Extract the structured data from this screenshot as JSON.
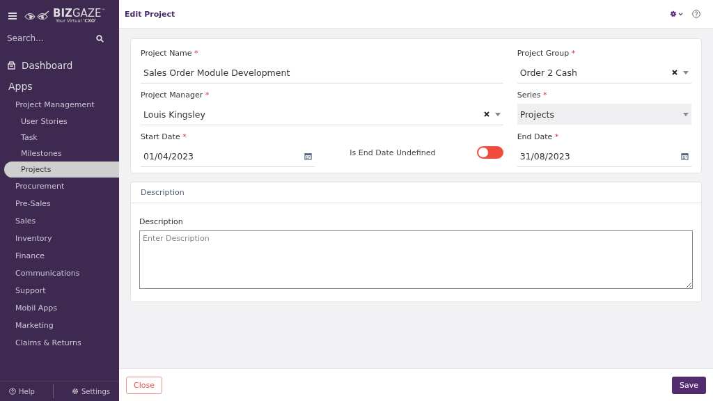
{
  "sidebar": {
    "logo": {
      "brand_bold": "BIZ",
      "brand": "GAZE",
      "tm": "™",
      "tagline": "Your Virtual **'CXO'**."
    },
    "search": {
      "placeholder": "Search..."
    },
    "dashboard": "Dashboard",
    "section": "Apps",
    "items": [
      {
        "label": "Project Management",
        "selected": false,
        "children": [
          {
            "label": "User Stories",
            "selected": false
          },
          {
            "label": "Task",
            "selected": false
          },
          {
            "label": "Milestones",
            "selected": false
          },
          {
            "label": "Projects",
            "selected": true
          }
        ]
      },
      {
        "label": "Procurement",
        "selected": false
      },
      {
        "label": "Pre-Sales",
        "selected": false
      },
      {
        "label": "Sales",
        "selected": false
      },
      {
        "label": "Inventory",
        "selected": false
      },
      {
        "label": "Finance",
        "selected": false
      },
      {
        "label": "Communications",
        "selected": false
      },
      {
        "label": "Support",
        "selected": false
      },
      {
        "label": "Mobil Apps",
        "selected": false
      },
      {
        "label": "Marketing",
        "selected": false
      },
      {
        "label": "Claims & Returns",
        "selected": false
      }
    ],
    "footer": {
      "help": "Help",
      "settings": "Settings"
    }
  },
  "header": {
    "title": "Edit Project"
  },
  "form": {
    "rows": [
      [
        {
          "kind": "text",
          "label": "Project Name",
          "required_mark": "*",
          "value": "Sales Order Module Development"
        },
        {
          "kind": "select",
          "label": "Project Group",
          "required_mark": "*",
          "value": "Order 2 Cash",
          "clearable": true,
          "disabled": false
        }
      ],
      [
        {
          "kind": "select",
          "label": "Project Manager",
          "required_mark": "*",
          "value": "Louis Kingsley",
          "clearable": true,
          "disabled": false
        },
        {
          "kind": "select",
          "label": "Series",
          "required_mark": "*",
          "value": "Projects",
          "clearable": false,
          "disabled": true
        }
      ],
      [
        {
          "kind": "date",
          "label": "Start Date",
          "required_mark": "*",
          "value": "01/04/2023"
        },
        {
          "kind": "toggle",
          "label": "Is End Date Undefined",
          "on": false
        },
        {
          "kind": "date",
          "label": "End Date",
          "required_mark": "*",
          "value": "31/08/2023"
        }
      ]
    ]
  },
  "description": {
    "heading": "Description",
    "label": "Description",
    "placeholder": "Enter Description"
  },
  "actions": {
    "close": "Close",
    "save": "Save"
  }
}
